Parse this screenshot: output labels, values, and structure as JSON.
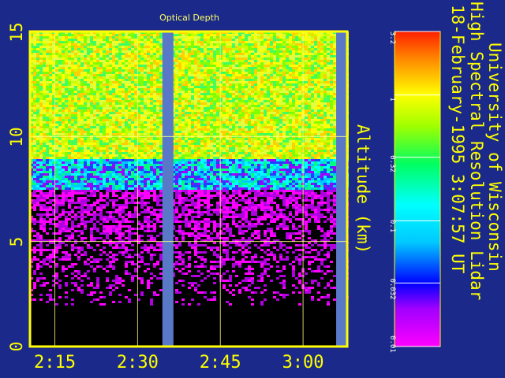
{
  "chart_data": {
    "type": "heatmap",
    "title": "Optical Depth",
    "ylabel": "Altitude (km)",
    "ylim": [
      0,
      15
    ],
    "yticks": [
      "0",
      "5",
      "10",
      "15"
    ],
    "xticks": [
      "2:15",
      "2:30",
      "2:45",
      "3:00"
    ],
    "x_tick_minutes": [
      135,
      150,
      165,
      180
    ],
    "xlim_minutes": [
      130.5,
      188
    ],
    "data_gaps_minutes": [
      [
        154.5,
        156.5
      ],
      [
        186,
        188
      ]
    ],
    "colorbar": {
      "ticks": [
        "3.2",
        "1",
        "0.32",
        "0.1",
        "0.032",
        "0.01"
      ],
      "values": [
        3.2,
        1,
        0.32,
        0.1,
        0.032,
        0.01
      ],
      "scale": "log"
    },
    "layers": [
      {
        "alt_from": 0,
        "alt_to": 2,
        "optical_depth": "none"
      },
      {
        "alt_from": 2,
        "alt_to": 7.5,
        "optical_depth": 0.01
      },
      {
        "alt_from": 7.5,
        "alt_to": 9,
        "optical_depth": 0.32
      },
      {
        "alt_from": 9,
        "alt_to": 15,
        "optical_depth": 1
      }
    ],
    "grid": true
  },
  "header": {
    "line1": "University of Wisconsin",
    "line2": "High Spectral Resolution Lidar",
    "line3": "18-February-1995   3:07:57 UT"
  },
  "colors": {
    "background": "#1b2a8a",
    "axes": "#ffff00",
    "gap": "#5a78c8"
  }
}
